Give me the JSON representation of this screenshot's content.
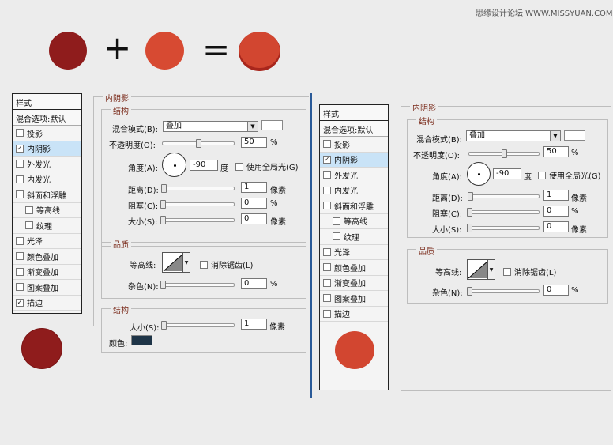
{
  "watermark": "思缘设计论坛  WWW.MISSYUAN.COM",
  "equation": {
    "plus": "+",
    "equals": "=",
    "colors": {
      "dark_red": "#8f1c1c",
      "light_red": "#d74a32",
      "result_red": "#d24630",
      "result_edge": "#a8261c"
    }
  },
  "styles_panel": {
    "header": "样式",
    "blending": "混合选项:默认",
    "items": [
      {
        "label": "投影",
        "checked": false,
        "active": false,
        "sub": false
      },
      {
        "label": "内阴影",
        "checked": true,
        "active": true,
        "sub": false
      },
      {
        "label": "外发光",
        "checked": false,
        "active": false,
        "sub": false
      },
      {
        "label": "内发光",
        "checked": false,
        "active": false,
        "sub": false
      },
      {
        "label": "斜面和浮雕",
        "checked": false,
        "active": false,
        "sub": false
      },
      {
        "label": "等高线",
        "checked": false,
        "active": false,
        "sub": true
      },
      {
        "label": "纹理",
        "checked": false,
        "active": false,
        "sub": true
      },
      {
        "label": "光泽",
        "checked": false,
        "active": false,
        "sub": false
      },
      {
        "label": "颜色叠加",
        "checked": false,
        "active": false,
        "sub": false
      },
      {
        "label": "渐变叠加",
        "checked": false,
        "active": false,
        "sub": false
      },
      {
        "label": "图案叠加",
        "checked": false,
        "active": false,
        "sub": false
      },
      {
        "label": "描边",
        "checked": true,
        "active": false,
        "sub": false
      }
    ],
    "items_right": [
      {
        "label": "投影",
        "checked": false,
        "active": false,
        "sub": false
      },
      {
        "label": "内阴影",
        "checked": true,
        "active": true,
        "sub": false
      },
      {
        "label": "外发光",
        "checked": false,
        "active": false,
        "sub": false
      },
      {
        "label": "内发光",
        "checked": false,
        "active": false,
        "sub": false
      },
      {
        "label": "斜面和浮雕",
        "checked": false,
        "active": false,
        "sub": false
      },
      {
        "label": "等高线",
        "checked": false,
        "active": false,
        "sub": true
      },
      {
        "label": "纹理",
        "checked": false,
        "active": false,
        "sub": true
      },
      {
        "label": "光泽",
        "checked": false,
        "active": false,
        "sub": false
      },
      {
        "label": "颜色叠加",
        "checked": false,
        "active": false,
        "sub": false
      },
      {
        "label": "渐变叠加",
        "checked": false,
        "active": false,
        "sub": false
      },
      {
        "label": "图案叠加",
        "checked": false,
        "active": false,
        "sub": false
      },
      {
        "label": "描边",
        "checked": false,
        "active": false,
        "sub": false
      }
    ]
  },
  "inner_shadow": {
    "title": "内阴影",
    "structure": "结构",
    "blend_mode_label": "混合模式(B):",
    "blend_mode_value": "叠加",
    "opacity_label": "不透明度(O):",
    "opacity_value": "50",
    "opacity_fraction": 0.5,
    "percent": "%",
    "angle_label": "角度(A):",
    "angle_value": "-90",
    "angle_unit": "度",
    "global_light": "使用全局光(G)",
    "distance_label": "距离(D):",
    "distance_value": "1",
    "choke_label": "阻塞(C):",
    "choke_value": "0",
    "size_label": "大小(S):",
    "size_value": "0",
    "pixels": "像素",
    "quality": "品质",
    "contour_label": "等高线:",
    "anti_alias": "消除锯齿(L)",
    "noise_label": "杂色(N):",
    "noise_value": "0"
  },
  "stroke": {
    "structure": "结构",
    "size_label": "大小(S):",
    "size_value": "1",
    "pixels": "像素",
    "color_label": "颜色:",
    "color": "#1e3447"
  },
  "colors": {
    "swatch_white": "#ffffff",
    "divider": "#2a5a98"
  }
}
